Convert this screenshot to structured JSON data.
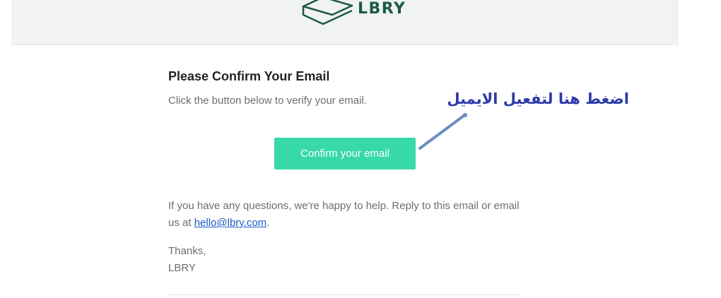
{
  "header": {
    "logo_text": "LBRY"
  },
  "email": {
    "title": "Please Confirm Your Email",
    "subtitle": "Click the button below to verify your email.",
    "button_label": "Confirm your email",
    "help_text_prefix": "If you have any questions, we're happy to help. Reply to this email or email us at ",
    "help_email": "hello@lbry.com",
    "help_text_suffix": ".",
    "signoff_thanks": "Thanks,",
    "signoff_name": "LBRY"
  },
  "annotation": {
    "text": "اضغط هنا لتفعيل الايميل"
  },
  "colors": {
    "header_background": "#f1f2f4",
    "logo": "#1d5a45",
    "button": "#38d9a9",
    "link": "#1a5cc8",
    "annotation": "#2c3aa8",
    "arrow": "#6a8ec4"
  },
  "icons": {
    "logo_mark": "lbry-logo-icon",
    "annotation_arrow": "arrow-icon"
  }
}
